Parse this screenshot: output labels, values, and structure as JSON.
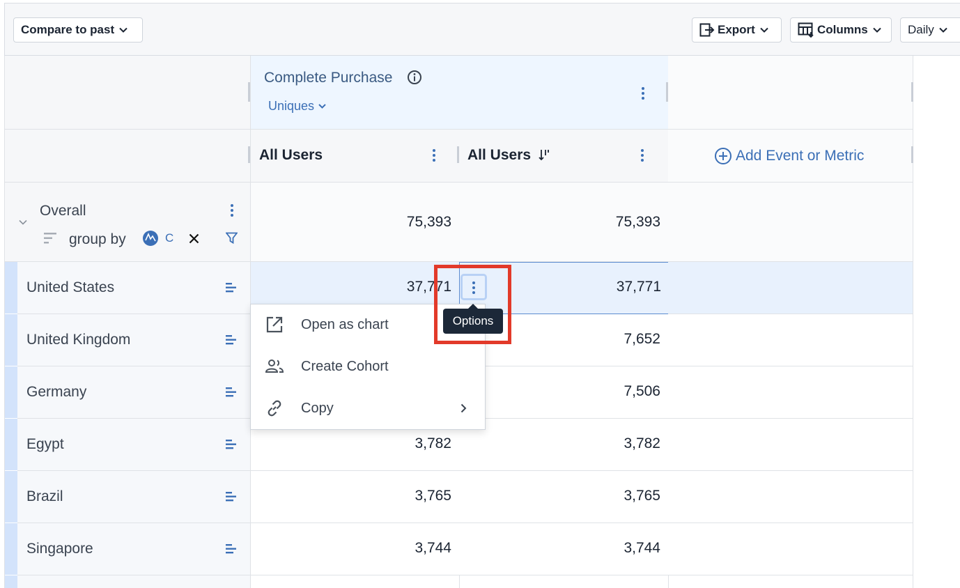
{
  "toolbar": {
    "compare_label": "Compare to past",
    "export_label": "Export",
    "columns_label": "Columns",
    "interval_label": "Daily"
  },
  "metric": {
    "title": "Complete Purchase",
    "aggregation": "Uniques"
  },
  "columns": [
    {
      "label": "All Users"
    },
    {
      "label": "All Users"
    }
  ],
  "add_metric_label": "Add Event or Metric",
  "overall": {
    "label": "Overall",
    "group_by_label": "group by",
    "chip_text": "C",
    "values": [
      "75,393",
      "75,393"
    ]
  },
  "rows": [
    {
      "label": "United States",
      "values": [
        "37,771",
        "37,771"
      ]
    },
    {
      "label": "United Kingdom",
      "values": [
        "",
        "7,652"
      ]
    },
    {
      "label": "Germany",
      "values": [
        "",
        "7,506"
      ]
    },
    {
      "label": "Egypt",
      "values": [
        "3,782",
        "3,782"
      ]
    },
    {
      "label": "Brazil",
      "values": [
        "3,765",
        "3,765"
      ]
    },
    {
      "label": "Singapore",
      "values": [
        "3,744",
        "3,744"
      ]
    }
  ],
  "menu": {
    "items": [
      {
        "label": "Open as chart",
        "icon": "open-external-icon"
      },
      {
        "label": "Create Cohort",
        "icon": "people-icon"
      },
      {
        "label": "Copy",
        "icon": "link-icon"
      }
    ]
  },
  "tooltip": "Options",
  "colors": {
    "accent": "#3b6fb6",
    "header_bg": "#eef6ff",
    "highlight": "#e23a2a",
    "tooltip_bg": "#1c2838"
  }
}
